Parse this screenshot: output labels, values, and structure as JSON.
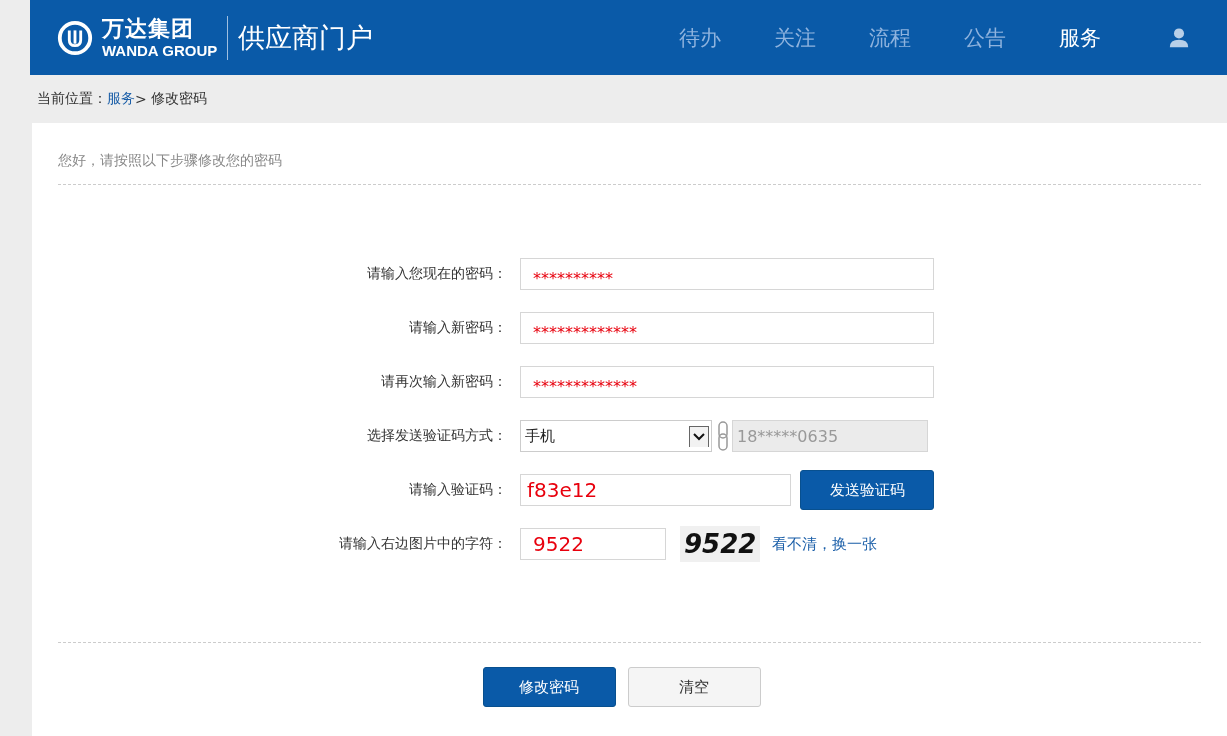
{
  "header": {
    "logo_cn": "万达集团",
    "logo_en": "WANDA GROUP",
    "portal_title": "供应商门户",
    "nav": [
      {
        "label": "待办",
        "selected": false
      },
      {
        "label": "关注",
        "selected": false
      },
      {
        "label": "流程",
        "selected": false
      },
      {
        "label": "公告",
        "selected": false
      },
      {
        "label": "服务",
        "selected": true
      }
    ]
  },
  "breadcrumb": {
    "prefix": "当前位置：",
    "link": "服务",
    "separator": ">",
    "current": "修改密码"
  },
  "intro": "您好，请按照以下步骤修改您的密码",
  "form": [
    {
      "kind": "password",
      "label": "请输入您现在的密码：",
      "value": "**********"
    },
    {
      "kind": "password",
      "label": "请输入新密码：",
      "value": "*************"
    },
    {
      "kind": "password",
      "label": "请再次输入新密码：",
      "value": "*************"
    },
    {
      "kind": "select",
      "label": "选择发送验证码方式：",
      "value": "手机",
      "phone": "18*****0635"
    },
    {
      "kind": "code",
      "label": "请输入验证码：",
      "value": "f83e12",
      "button": "发送验证码"
    },
    {
      "kind": "captcha",
      "label": "请输入右边图片中的字符：",
      "value": "9522",
      "captcha_text": "9522",
      "refresh_link": "看不清，换一张"
    }
  ],
  "buttons": [
    {
      "label": "修改密码",
      "kind": "primary"
    },
    {
      "label": "清空",
      "kind": "secondary"
    }
  ]
}
